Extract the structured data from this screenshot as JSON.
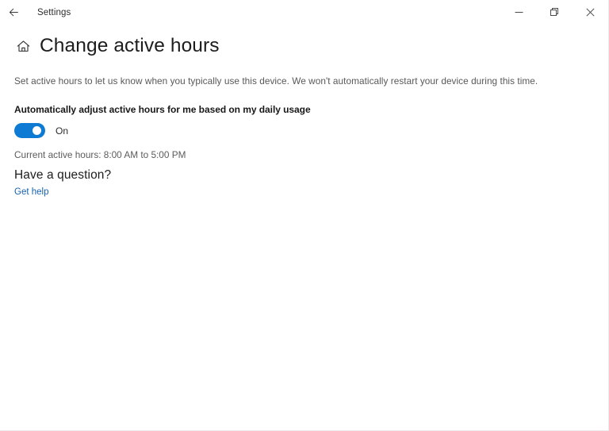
{
  "window": {
    "titlebar": {
      "back_icon": "back-arrow-icon",
      "title": "Settings",
      "minimize_label": "Minimize",
      "restore_label": "Restore",
      "close_label": "Close"
    }
  },
  "page": {
    "home_icon": "home-icon",
    "title": "Change active hours",
    "description": "Set active hours to let us know when you typically use this device. We won't automatically restart your device during this time.",
    "auto_adjust": {
      "label": "Automatically adjust active hours for me based on my daily usage",
      "toggle_state": "On",
      "toggle_on": true
    },
    "current_hours": {
      "label": "Current active hours:",
      "value": "8:00 AM to  5:00 PM",
      "start_time": "8:00 AM",
      "end_time": "5:00 PM"
    },
    "help": {
      "heading": "Have a question?",
      "link_label": "Get help"
    }
  },
  "colors": {
    "accent": "#0d7bd4",
    "link": "#1762ab",
    "background": "#ffffff",
    "text_primary": "#1d1d1d",
    "text_secondary": "#5c5c5c"
  }
}
